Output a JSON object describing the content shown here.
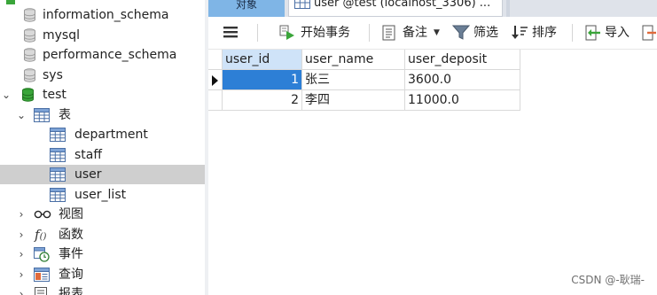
{
  "sidebar": {
    "items": [
      {
        "label": "information_schema",
        "icon": "database-icon"
      },
      {
        "label": "mysql",
        "icon": "database-icon"
      },
      {
        "label": "performance_schema",
        "icon": "database-icon"
      },
      {
        "label": "sys",
        "icon": "database-icon"
      },
      {
        "label": "test",
        "icon": "database-icon-active",
        "expanded": true
      },
      {
        "label": "表",
        "icon": "tables-folder-icon",
        "expanded": true
      },
      {
        "label": "department",
        "icon": "table-icon"
      },
      {
        "label": "staff",
        "icon": "table-icon"
      },
      {
        "label": "user",
        "icon": "table-icon",
        "selected": true
      },
      {
        "label": "user_list",
        "icon": "table-icon"
      },
      {
        "label": "视图",
        "icon": "views-icon"
      },
      {
        "label": "函数",
        "icon": "functions-icon"
      },
      {
        "label": "事件",
        "icon": "events-icon"
      },
      {
        "label": "查询",
        "icon": "queries-icon"
      },
      {
        "label": "报表",
        "icon": "reports-icon"
      }
    ]
  },
  "tabs": {
    "objects_label": "对象",
    "active_label": "user @test (localhost_3306) ..."
  },
  "toolbar": {
    "begin_transaction": "开始事务",
    "memo": "备注",
    "filter": "筛选",
    "sort": "排序",
    "import": "导入"
  },
  "grid": {
    "columns": [
      "user_id",
      "user_name",
      "user_deposit"
    ],
    "rows": [
      {
        "user_id": "1",
        "user_name": "张三",
        "user_deposit": "3600.0"
      },
      {
        "user_id": "2",
        "user_name": "李四",
        "user_deposit": "11000.0"
      }
    ]
  },
  "watermark": "CSDN @-耿瑞-",
  "colors": {
    "accent": "#2d7fd6",
    "db_active": "#3aa53a",
    "selection": "#cfcfcf"
  }
}
